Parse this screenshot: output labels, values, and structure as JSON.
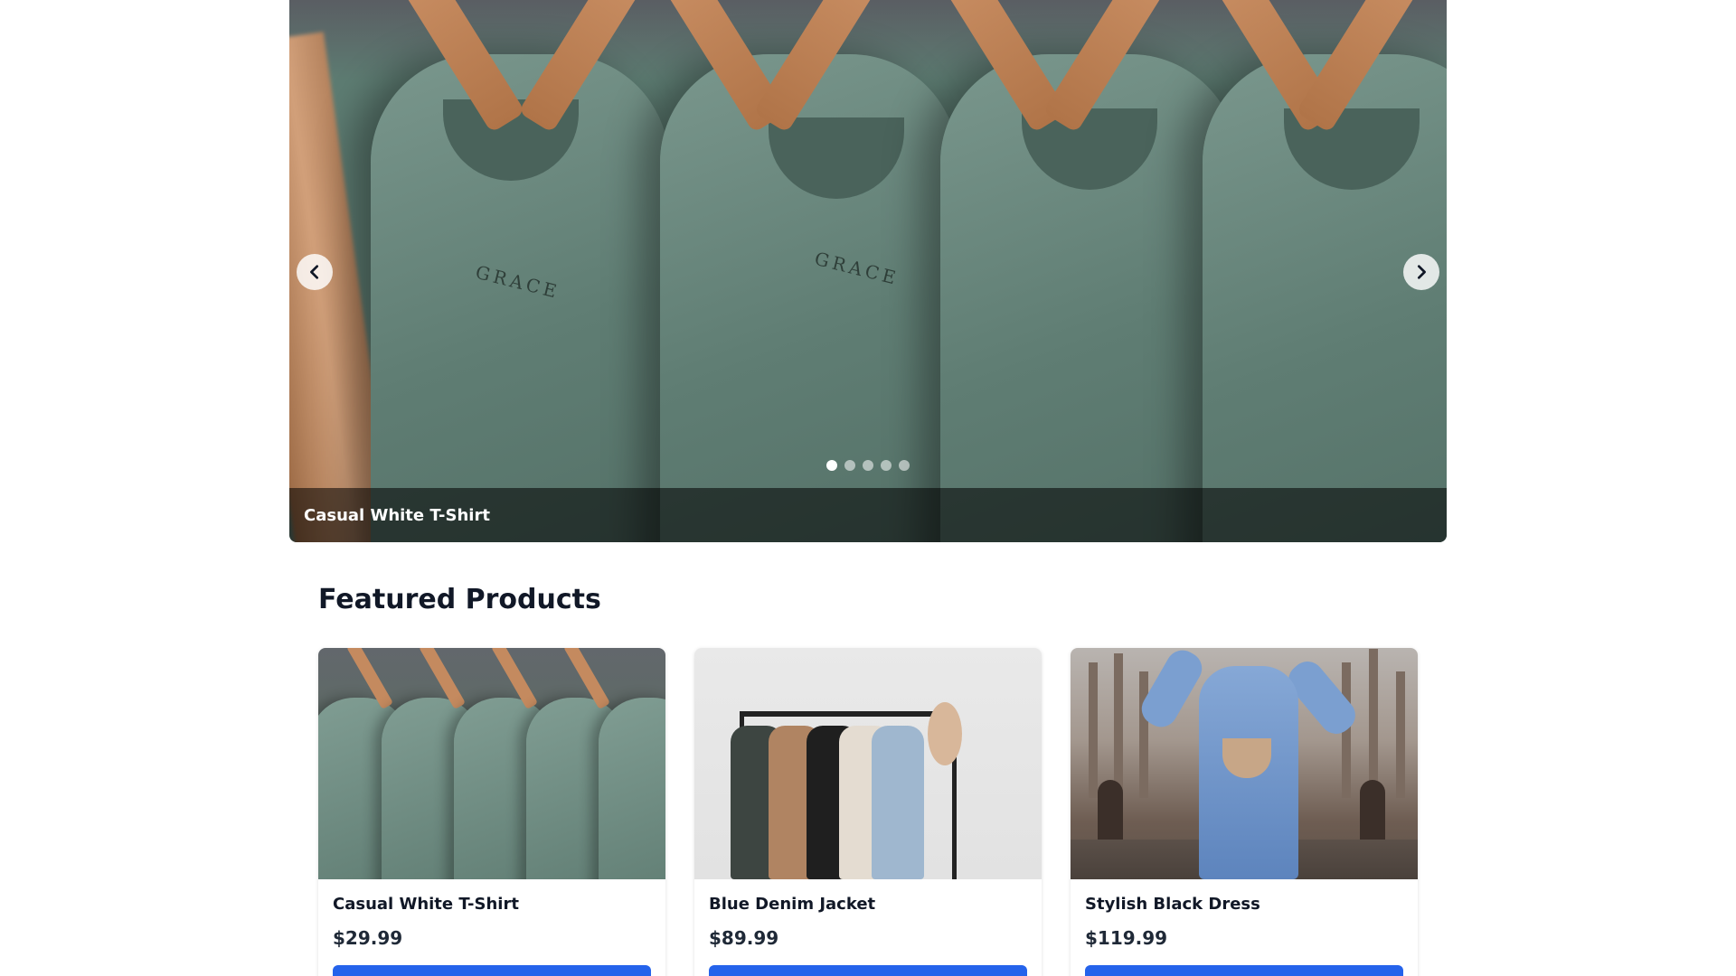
{
  "carousel": {
    "active_caption": "Casual White T-Shirt",
    "slide_count": 5,
    "active_index": 0,
    "prev_icon": "chevron-left-icon",
    "next_icon": "chevron-right-icon",
    "slide_label_text": "GRACE"
  },
  "featured": {
    "title": "Featured Products",
    "products": [
      {
        "name": "Casual White T-Shirt",
        "price": "$29.99",
        "image": "green-shirts-on-hangers"
      },
      {
        "name": "Blue Denim Jacket",
        "price": "$89.99",
        "image": "clothes-rack"
      },
      {
        "name": "Stylish Black Dress",
        "price": "$119.99",
        "image": "woman-in-blue-coat-at-cathedral"
      }
    ]
  },
  "colors": {
    "accent": "#2563eb",
    "caption_overlay": "rgba(0,0,0,0.55)"
  }
}
